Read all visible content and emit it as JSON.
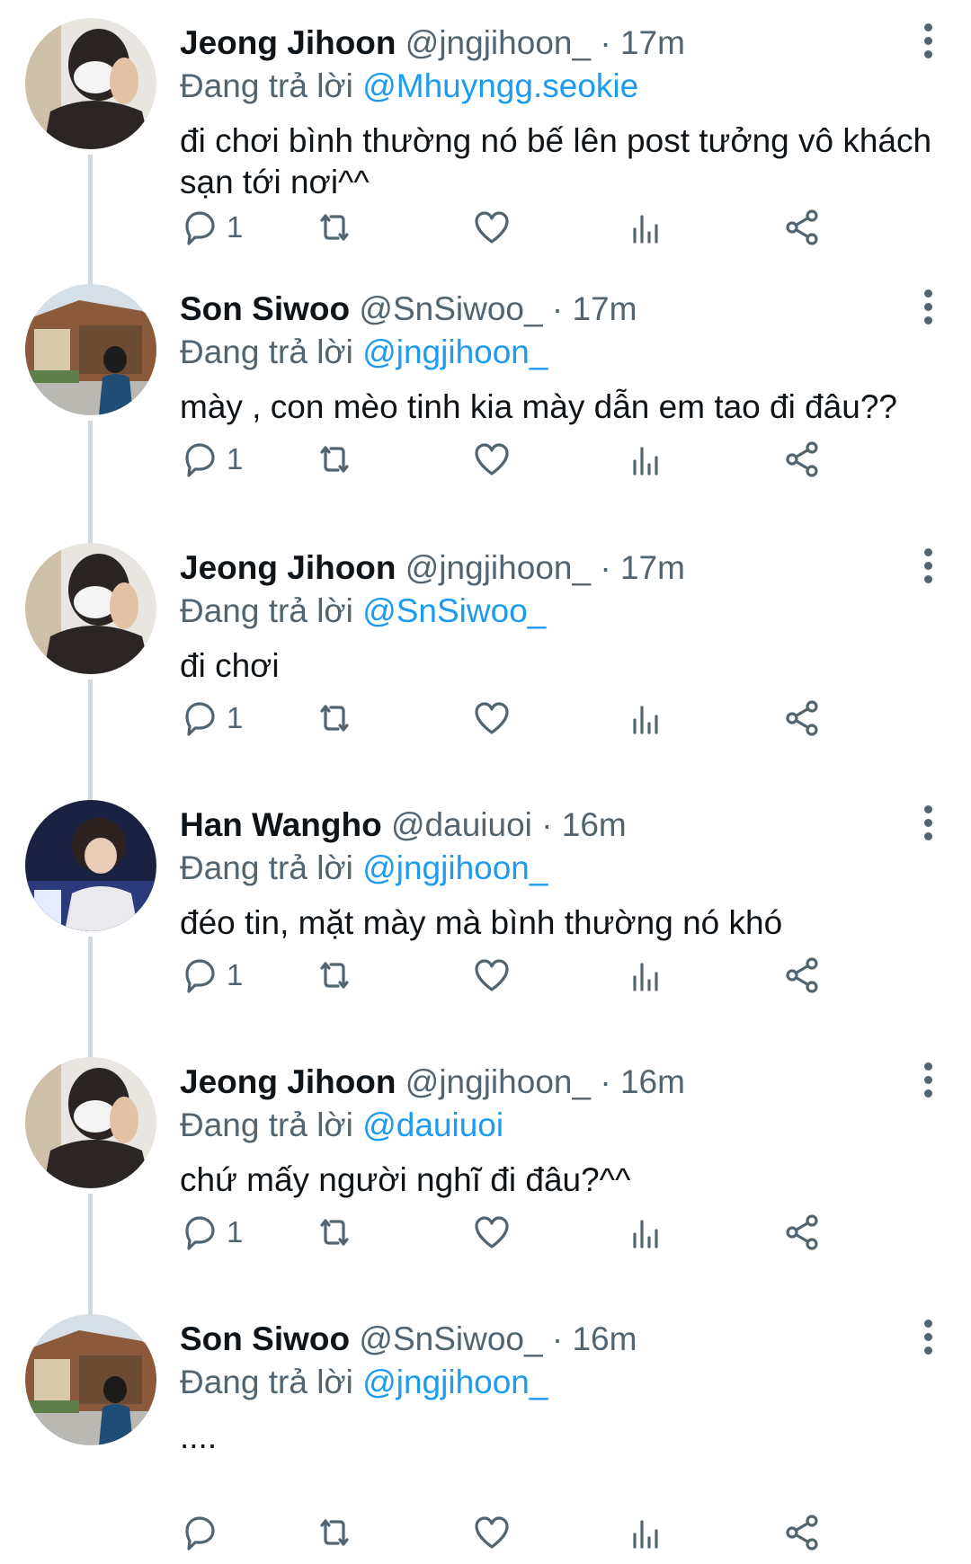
{
  "tweets": [
    {
      "name": "Jeong Jihoon",
      "handle": "@jngjihoon_",
      "time": "17m",
      "reply_prefix": "Đang trả lời",
      "reply_to": "@Mhuyngg.seokie",
      "text": "đi chơi bình thường nó bế lên post tưởng vô khách sạn tới nơi^^",
      "reply_count": "1",
      "avatar": "avatar-jihoon"
    },
    {
      "name": "Son Siwoo",
      "handle": "@SnSiwoo_",
      "time": "17m",
      "reply_prefix": "Đang trả lời",
      "reply_to": "@jngjihoon_",
      "text": "mày , con mèo tinh kia mày dẫn em tao đi đâu??",
      "reply_count": "1",
      "avatar": "avatar-siwoo"
    },
    {
      "name": "Jeong Jihoon",
      "handle": "@jngjihoon_",
      "time": "17m",
      "reply_prefix": "Đang trả lời",
      "reply_to": "@SnSiwoo_",
      "text": "đi chơi",
      "reply_count": "1",
      "avatar": "avatar-jihoon"
    },
    {
      "name": "Han Wangho",
      "handle": "@dauiuoi",
      "time": "16m",
      "reply_prefix": "Đang trả lời",
      "reply_to": "@jngjihoon_",
      "text": "đéo tin, mặt mày mà bình thường nó khó",
      "reply_count": "1",
      "avatar": "avatar-wangho"
    },
    {
      "name": "Jeong Jihoon",
      "handle": "@jngjihoon_",
      "time": "16m",
      "reply_prefix": "Đang trả lời",
      "reply_to": "@dauiuoi",
      "text": "chứ mấy người nghĩ đi đâu?^^",
      "reply_count": "1",
      "avatar": "avatar-jihoon"
    },
    {
      "name": "Son Siwoo",
      "handle": "@SnSiwoo_",
      "time": "16m",
      "reply_prefix": "Đang trả lời",
      "reply_to": "@jngjihoon_",
      "text": "....",
      "reply_count": "",
      "avatar": "avatar-siwoo"
    }
  ],
  "icons": {
    "reply": "reply-icon",
    "retweet": "retweet-icon",
    "like": "heart-icon",
    "views": "bar-chart-icon",
    "share": "share-icon",
    "more": "more-vertical-icon"
  },
  "colors": {
    "link": "#1d9bf0",
    "muted": "#536471",
    "text": "#0f1419",
    "thread_line": "#cfd9de"
  }
}
